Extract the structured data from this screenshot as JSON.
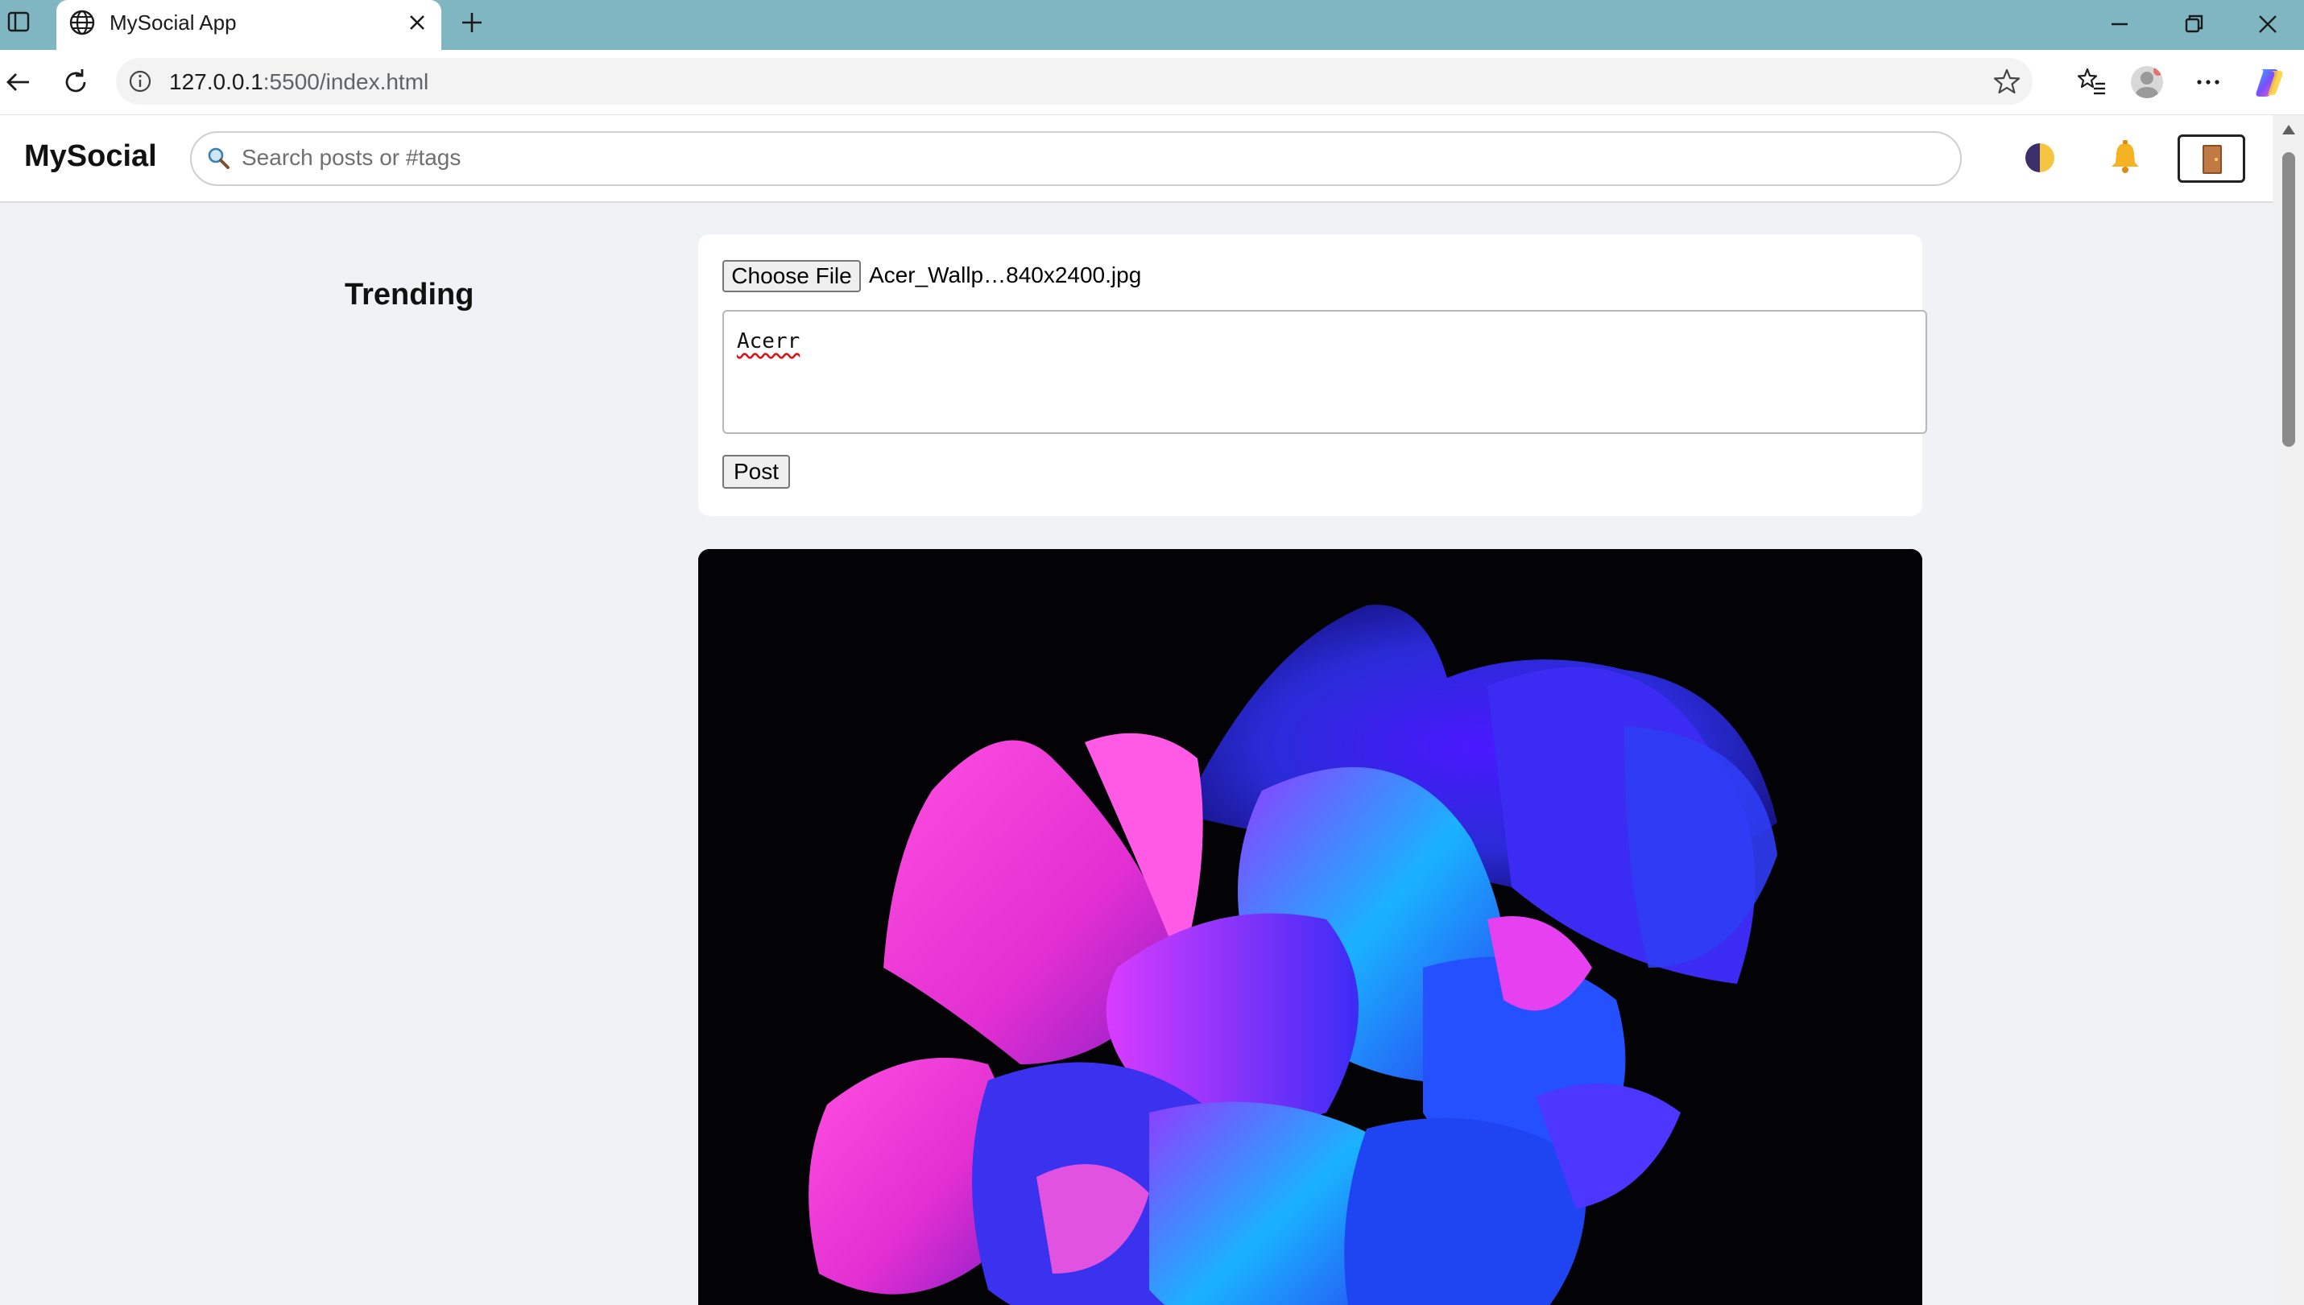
{
  "browser": {
    "tab_title": "MySocial App",
    "url_host": "127.0.0.1",
    "url_path": ":5500/index.html"
  },
  "app": {
    "brand": "MySocial",
    "search_placeholder": "Search posts or #tags",
    "header_icons": [
      "theme-toggle-icon",
      "bell-icon",
      "door-icon"
    ]
  },
  "sidebar": {
    "heading": "Trending"
  },
  "composer": {
    "choose_file_label": "Choose File",
    "file_name": "Acer_Wallp…840x2400.jpg",
    "text_value": "Acerr",
    "post_label": "Post"
  },
  "post": {
    "image_subject": "flower-image"
  },
  "colors": {
    "titlebar": "#80b6c2",
    "page_background": "#f1f2f6"
  }
}
